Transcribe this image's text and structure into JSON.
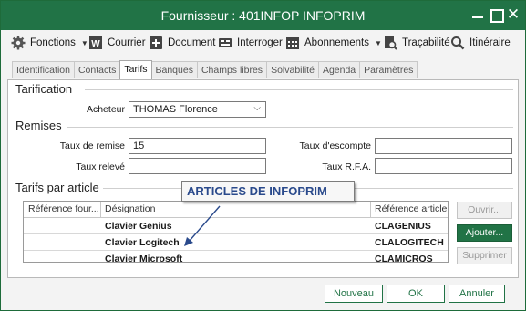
{
  "window": {
    "title": "Fournisseur : 401INFOP INFOPRIM"
  },
  "toolbar": {
    "fonctions": "Fonctions",
    "courrier": "Courrier",
    "document": "Document",
    "interroger": "Interroger",
    "abonnements": "Abonnements",
    "tracabilite": "Traçabilité",
    "itineraire": "Itinéraire"
  },
  "tabs": [
    "Identification",
    "Contacts",
    "Tarifs",
    "Banques",
    "Champs libres",
    "Solvabilité",
    "Agenda",
    "Paramètres"
  ],
  "active_tab": "Tarifs",
  "tarification": {
    "section_title": "Tarification",
    "acheteur_label": "Acheteur",
    "acheteur_value": "THOMAS Florence"
  },
  "remises": {
    "section_title": "Remises",
    "taux_remise_label": "Taux de remise",
    "taux_remise_value": "15",
    "taux_releve_label": "Taux relevé",
    "taux_releve_value": "",
    "taux_escompte_label": "Taux d'escompte",
    "taux_escompte_value": "",
    "taux_rfa_label": "Taux R.F.A.",
    "taux_rfa_value": ""
  },
  "tarifs_article": {
    "section_title": "Tarifs par article",
    "columns": [
      "Référence four...",
      "Désignation",
      "Référence article"
    ],
    "rows": [
      {
        "designation": "Clavier Genius",
        "reference": "CLAGENIUS"
      },
      {
        "designation": "Clavier Logitech",
        "reference": "CLALOGITECH"
      },
      {
        "designation": "Clavier Microsoft",
        "reference": "CLAMICROS"
      }
    ],
    "ouvrir_label": "Ouvrir...",
    "ajouter_label": "Ajouter...",
    "supprimer_label": "Supprimer"
  },
  "annotation": {
    "text": "ARTICLES DE INFOPRIM"
  },
  "footer": {
    "nouveau": "Nouveau",
    "ok": "OK",
    "annuler": "Annuler"
  },
  "colors": {
    "accent": "#217346",
    "annotation_text": "#2a4a8c"
  }
}
